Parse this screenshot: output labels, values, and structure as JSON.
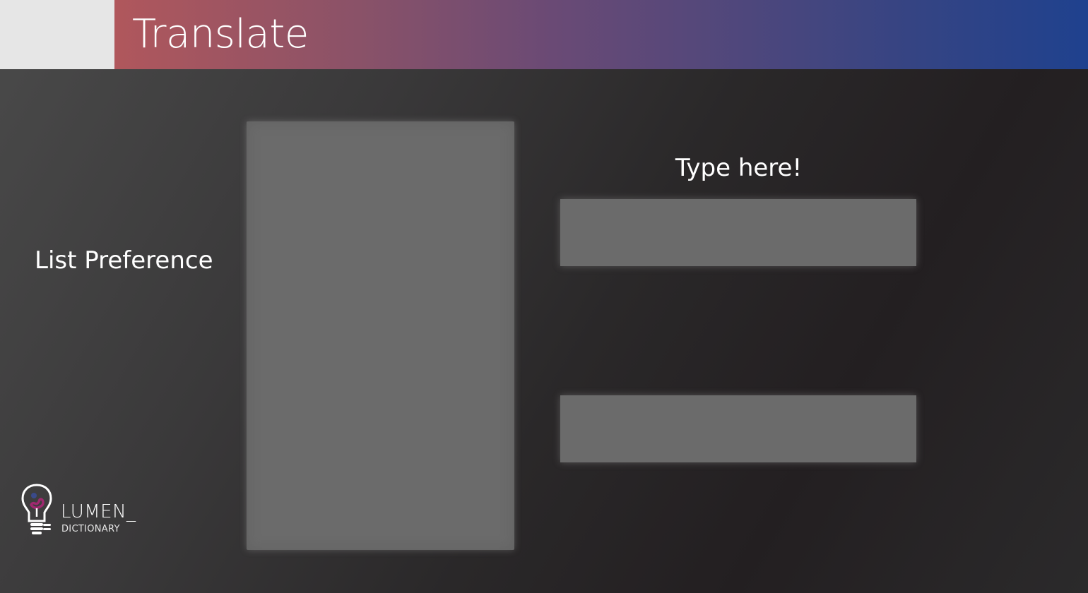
{
  "header": {
    "title": "Translate"
  },
  "preferences": {
    "label": "List Preference",
    "options": []
  },
  "translator": {
    "prompt": "Type here!",
    "input_value": "",
    "output_value": ""
  },
  "logo": {
    "wordmark": "LUMEN_",
    "subtitle": "DICTIONARY",
    "icon": "lightbulb-icon"
  },
  "colors": {
    "banner_start": "#b0575c",
    "banner_end": "#1f418e",
    "panel": "#6b6b6b",
    "logo_accent": "#a02870"
  }
}
